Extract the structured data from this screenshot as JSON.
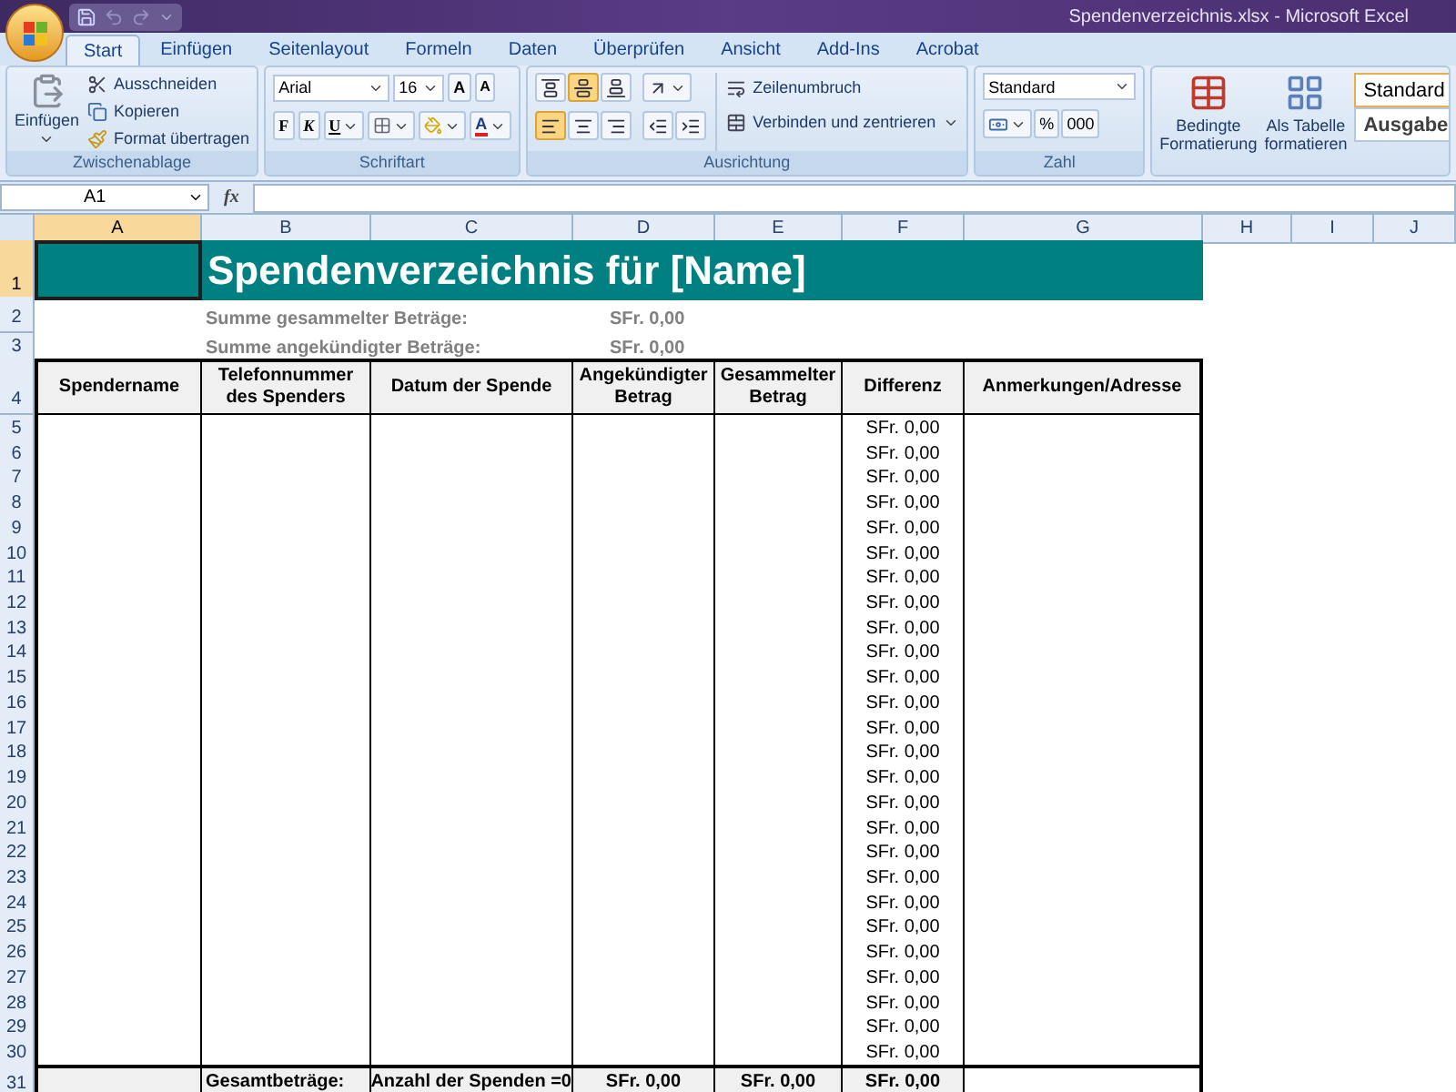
{
  "window": {
    "title": "Spendenverzeichnis.xlsx - Microsoft Excel"
  },
  "tabs": [
    {
      "label": "Start",
      "selected": true
    },
    {
      "label": "Einfügen",
      "selected": false
    },
    {
      "label": "Seitenlayout",
      "selected": false
    },
    {
      "label": "Formeln",
      "selected": false
    },
    {
      "label": "Daten",
      "selected": false
    },
    {
      "label": "Überprüfen",
      "selected": false
    },
    {
      "label": "Ansicht",
      "selected": false
    },
    {
      "label": "Add-Ins",
      "selected": false
    },
    {
      "label": "Acrobat",
      "selected": false
    }
  ],
  "ribbon": {
    "clipboard": {
      "paste": "Einfügen",
      "cut": "Ausschneiden",
      "copy": "Kopieren",
      "format_painter": "Format übertragen",
      "label": "Zwischenablage"
    },
    "font": {
      "name": "Arial",
      "size": "16",
      "grow": "A",
      "shrink": "A",
      "bold": "F",
      "italic": "K",
      "underline": "U",
      "font_color": "A",
      "label": "Schriftart"
    },
    "alignment": {
      "vertical": [
        {
          "selected": false
        },
        {
          "selected": true
        },
        {
          "selected": false
        }
      ],
      "horizontal": [
        {
          "selected": true
        },
        {
          "selected": false
        },
        {
          "selected": false
        }
      ],
      "wrap": "Zeilenumbruch",
      "merge": "Verbinden und zentrieren",
      "label": "Ausrichtung"
    },
    "number": {
      "format": "Standard",
      "percent": "%",
      "thousands": "000",
      "label": "Zahl"
    },
    "styles": {
      "conditional": "Bedingte Formatierung",
      "as_table": "Als Tabelle formatieren",
      "cell_styles": [
        "Standard",
        "Ausgabe"
      ]
    }
  },
  "formula_bar": {
    "name_box": "A1",
    "function_label": "fx"
  },
  "columns": [
    {
      "label": "A",
      "selected": true
    },
    {
      "label": "B",
      "selected": false
    },
    {
      "label": "C",
      "selected": false
    },
    {
      "label": "D",
      "selected": false
    },
    {
      "label": "E",
      "selected": false
    },
    {
      "label": "F",
      "selected": false
    },
    {
      "label": "G",
      "selected": false
    },
    {
      "label": "H",
      "selected": false
    },
    {
      "label": "I",
      "selected": false
    },
    {
      "label": "J",
      "selected": false
    }
  ],
  "sheet": {
    "title_row": {
      "number": "1",
      "selected": true
    },
    "title": "Spendenverzeichnis für [Name]",
    "summary": [
      {
        "row": "2",
        "label": "Summe gesammelter Beträge:",
        "value": "SFr. 0,00"
      },
      {
        "row": "3",
        "label": "Summe angekündigter Beträge:",
        "value": "SFr. 0,00"
      }
    ],
    "header_row": "4",
    "headers": [
      "Spendername",
      "Telefonnummer des Spenders",
      "Datum der Spende",
      "Angekündigter Betrag",
      "Gesammelter Betrag",
      "Differenz",
      "Anmerkungen/Adresse"
    ],
    "rows": [
      {
        "row": "5",
        "difference": "SFr. 0,00"
      },
      {
        "row": "6",
        "difference": "SFr. 0,00"
      },
      {
        "row": "7",
        "difference": "SFr. 0,00"
      },
      {
        "row": "8",
        "difference": "SFr. 0,00"
      },
      {
        "row": "9",
        "difference": "SFr. 0,00"
      },
      {
        "row": "10",
        "difference": "SFr. 0,00"
      },
      {
        "row": "11",
        "difference": "SFr. 0,00"
      },
      {
        "row": "12",
        "difference": "SFr. 0,00"
      },
      {
        "row": "13",
        "difference": "SFr. 0,00"
      },
      {
        "row": "14",
        "difference": "SFr. 0,00"
      },
      {
        "row": "15",
        "difference": "SFr. 0,00"
      },
      {
        "row": "16",
        "difference": "SFr. 0,00"
      },
      {
        "row": "17",
        "difference": "SFr. 0,00"
      },
      {
        "row": "18",
        "difference": "SFr. 0,00"
      },
      {
        "row": "19",
        "difference": "SFr. 0,00"
      },
      {
        "row": "20",
        "difference": "SFr. 0,00"
      },
      {
        "row": "21",
        "difference": "SFr. 0,00"
      },
      {
        "row": "22",
        "difference": "SFr. 0,00"
      },
      {
        "row": "23",
        "difference": "SFr. 0,00"
      },
      {
        "row": "24",
        "difference": "SFr. 0,00"
      },
      {
        "row": "25",
        "difference": "SFr. 0,00"
      },
      {
        "row": "26",
        "difference": "SFr. 0,00"
      },
      {
        "row": "27",
        "difference": "SFr. 0,00"
      },
      {
        "row": "28",
        "difference": "SFr. 0,00"
      },
      {
        "row": "29",
        "difference": "SFr. 0,00"
      },
      {
        "row": "30",
        "difference": "SFr. 0,00"
      }
    ],
    "totals": {
      "row": "31",
      "label": "Gesamtbeträge:",
      "count": "Anzahl der Spenden =0",
      "announced": "SFr. 0,00",
      "collected": "SFr. 0,00",
      "difference": "SFr. 0,00"
    }
  }
}
